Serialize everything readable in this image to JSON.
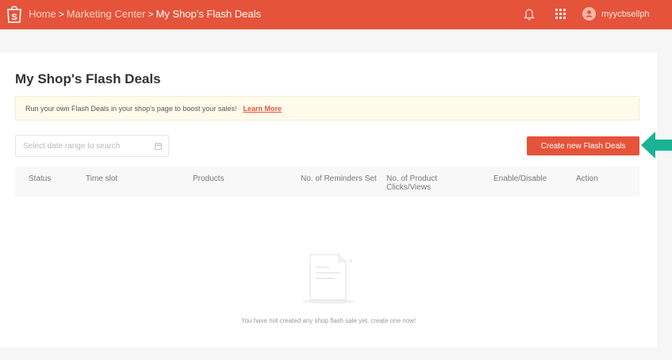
{
  "topbar": {
    "logo_icon": "shopee-bag-icon",
    "breadcrumb": {
      "home": "Home",
      "sep": ">",
      "marketing": "Marketing Center",
      "current": "My Shop's Flash Deals"
    },
    "bell_icon": "bell-icon",
    "apps_icon": "apps-grid-icon",
    "avatar_icon": "user-avatar-icon",
    "username": "myycbsellph",
    "color": "#e5533a"
  },
  "page": {
    "title": "My Shop's Flash Deals",
    "banner_text": "Run your own Flash Deals in your shop's page to boost your sales!",
    "banner_link": "Learn More",
    "date_placeholder": "Select date range to search",
    "create_button": "Create new Flash Deals",
    "accent_color": "#e5533a",
    "annotation_arrow_color": "#19b394"
  },
  "table": {
    "columns": {
      "status": "Status",
      "time_slot": "Time slot",
      "products": "Products",
      "reminders": "No. of Reminders Set",
      "clicks_line1": "No. of Product",
      "clicks_line2": "Clicks/Views",
      "enable": "Enable/Disable",
      "action": "Action"
    },
    "empty_text": "You have not created any shop flash sale yet, create one now!"
  }
}
